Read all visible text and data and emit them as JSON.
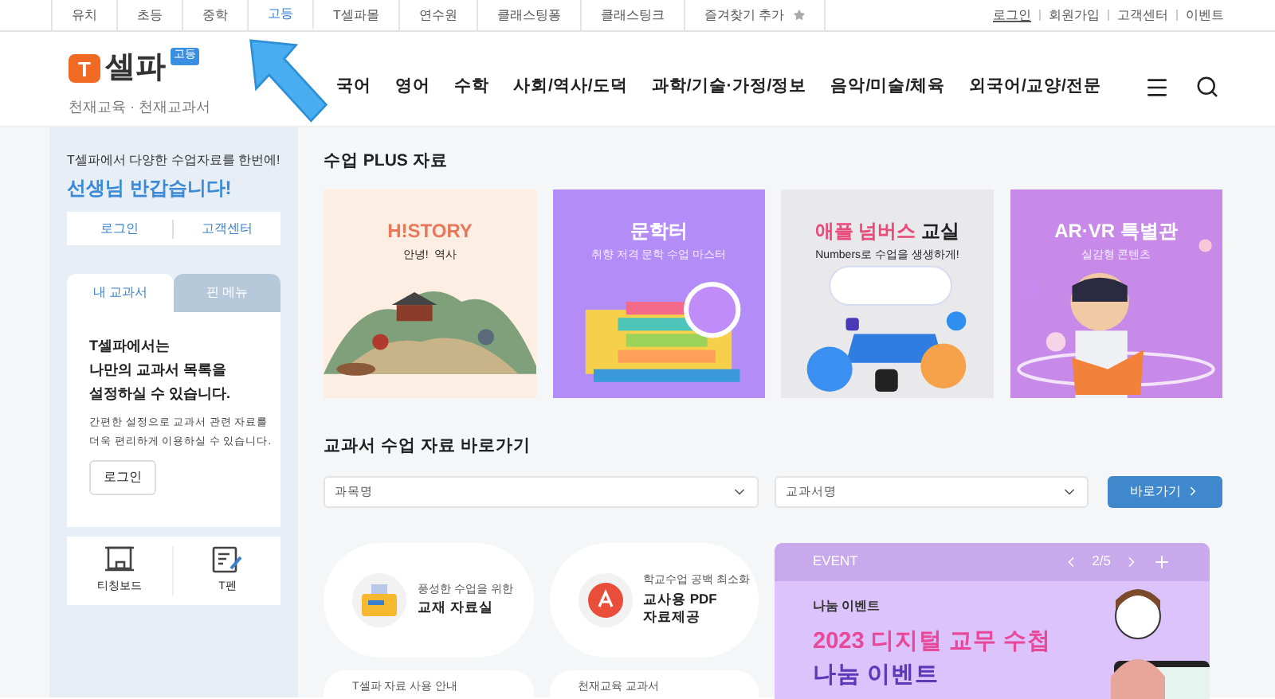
{
  "top_nav": {
    "tabs": [
      {
        "label": "유치",
        "selected": false
      },
      {
        "label": "초등",
        "selected": false
      },
      {
        "label": "중학",
        "selected": false
      },
      {
        "label": "고등",
        "selected": true
      },
      {
        "label": "T셀파몰",
        "selected": false
      },
      {
        "label": "연수원",
        "selected": false
      },
      {
        "label": "클래스팅퐁",
        "selected": false
      },
      {
        "label": "클래스팅크",
        "selected": false
      },
      {
        "label": "즐겨찾기 추가",
        "selected": false
      }
    ],
    "links": [
      "로그인",
      "회원가입",
      "고객센터",
      "이벤트"
    ]
  },
  "header": {
    "logo": {
      "letter": "T",
      "name": "셀파",
      "badge": "고등",
      "sub": "천재교육 · 천재교과서"
    },
    "menu": [
      "국어",
      "영어",
      "수학",
      "사회/역사/도덕",
      "과학/기술·가정/정보",
      "음악/미술/체육",
      "외국어/교양/전문"
    ]
  },
  "sidebar": {
    "intro": "T셀파에서 다양한 수업자료를 한번에!",
    "greeting": "선생님 반갑습니다!",
    "links": [
      "로그인",
      "고객센터"
    ],
    "tabs": [
      {
        "label": "내 교과서",
        "selected": true
      },
      {
        "label": "핀 메뉴",
        "selected": false
      }
    ],
    "panel": {
      "title": "T셀파에서는\n나만의 교과서 목록을\n설정하실 수 있습니다.",
      "text": "간편한 설정으로 교과서 관련 자료를\n더욱 편리하게 이용하실 수 있습니다.",
      "button": "로그인"
    },
    "tools": [
      {
        "kind": "board",
        "label": "티칭보드"
      },
      {
        "kind": "pen",
        "label": "T펜"
      }
    ]
  },
  "plus": {
    "title": "수업 PLUS 자료",
    "cards": [
      {
        "kind": "history",
        "title": "H!STORY",
        "subtitle": "안녕!  역사"
      },
      {
        "kind": "literature",
        "title": "문학터",
        "subtitle": "취향 저격 문학 수업 마스터"
      },
      {
        "kind": "numbers",
        "title": "애플 넘버스",
        "title_rest": "교실",
        "subtitle": "Numbers로 수업을 생생하게!"
      },
      {
        "kind": "vr",
        "title": "AR·VR 특별관",
        "subtitle": "실감형 콘텐츠"
      }
    ]
  },
  "shortcut": {
    "title": "교과서 수업 자료 바로가기",
    "selects": [
      {
        "placeholder": "과목명"
      },
      {
        "placeholder": "교과서명"
      }
    ],
    "button": "바로가기"
  },
  "quick": [
    {
      "kind": "folder",
      "sub": "풍성한 수업을 위한",
      "title": "교재 자료실"
    },
    {
      "kind": "pdf",
      "sub": "학교수업 공백 최소화",
      "title": "교사용 PDF\n자료제공"
    },
    {
      "kind": "guide",
      "sub": "T셀파 자료 사용 안내"
    },
    {
      "kind": "book",
      "sub": "천재교육 교과서"
    }
  ],
  "event": {
    "label": "EVENT",
    "pager": "2/5",
    "small": "나눔 이벤트",
    "headline": "2023 디지털 교무 수첩",
    "headline2": "나눔 이벤트"
  }
}
